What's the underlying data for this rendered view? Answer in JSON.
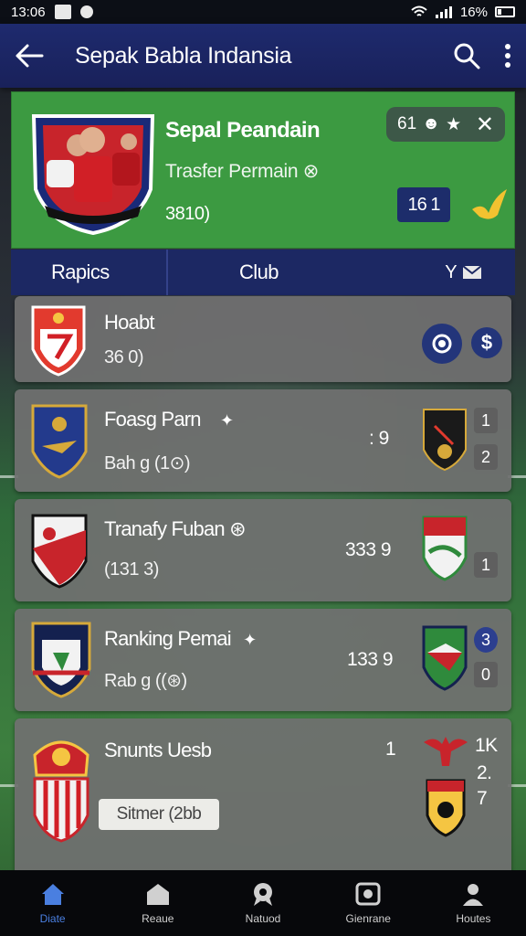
{
  "status_bar": {
    "time": "13:06",
    "battery": "16%"
  },
  "app_bar": {
    "title": "Sepak Babla Indansia"
  },
  "featured": {
    "title": "Sepal Peandain",
    "subtitle": "Trasfer Permain ⊗",
    "number": "3810)",
    "pill_value": "61",
    "score": "16 1"
  },
  "tabs": [
    {
      "label": "Rapics"
    },
    {
      "label": "Club"
    },
    {
      "label": "Y"
    }
  ],
  "cards": [
    {
      "name": "Hoabt",
      "sub": "36 0)"
    },
    {
      "name": "Foasg Parn",
      "sub": "Bah g (1⊙)",
      "mid": ": 9",
      "stat1": "1",
      "stat2": "2"
    },
    {
      "name": "Tranafy Fuban ⊛",
      "sub": "(131 3)",
      "mid": "333 9",
      "stat1": "1"
    },
    {
      "name": "Ranking Pemai",
      "sub": "Rab g ((⊛)",
      "mid": "133 9",
      "stat1": "3",
      "stat2": "0"
    },
    {
      "name": "Snunts Uesb",
      "pill": "Sitmer (2bb",
      "mid": "1",
      "right1": "1K",
      "right2": "2.",
      "right3": "7"
    }
  ],
  "bottom_nav": [
    {
      "label": "Diate",
      "icon": "home-icon"
    },
    {
      "label": "Reaue",
      "icon": "house-icon"
    },
    {
      "label": "Natuod",
      "icon": "ribbon-icon"
    },
    {
      "label": "Gienrane",
      "icon": "camera-icon"
    },
    {
      "label": "Houtes",
      "icon": "user-icon"
    }
  ],
  "colors": {
    "app_bar": "#1e2a6e",
    "featured_bg": "#3c9a41",
    "tab_bar": "#1c2863",
    "card_bg": "#707070",
    "active_nav": "#4a7fe0"
  }
}
